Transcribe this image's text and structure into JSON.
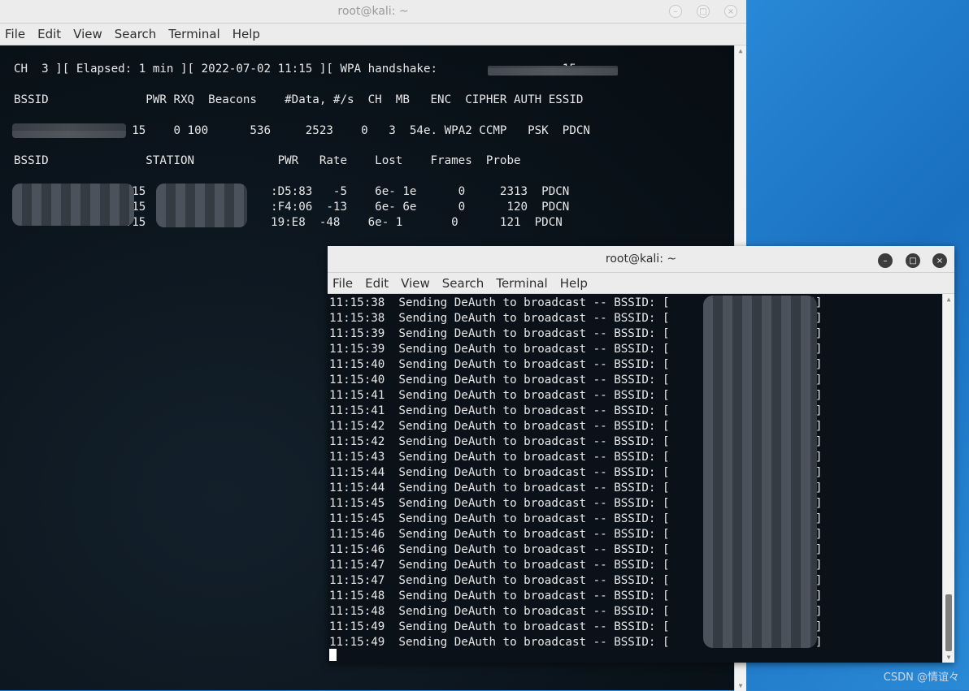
{
  "win_a": {
    "title": "root@kali: ~",
    "menu": [
      "File",
      "Edit",
      "View",
      "Search",
      "Terminal",
      "Help"
    ],
    "lines": [
      "CH  3 ][ Elapsed: 1 min ][ 2022-07-02 11:15 ][ WPA handshake:                  15",
      "BSSID              PWR RXQ  Beacons    #Data, #/s  CH  MB   ENC  CIPHER AUTH ESSID",
      "                 15    0 100      536     2523    0   3  54e. WPA2 CCMP   PSK  PDCN",
      "BSSID              STATION            PWR   Rate    Lost    Frames  Probe",
      "                :15                  :D5:83   -5    6e- 1e      0     2313  PDCN",
      "                 15                  :F4:06  -13    6e- 6e      0      120  PDCN",
      "                :15                  19:E8  -48    6e- 1       0      121  PDCN"
    ]
  },
  "win_b": {
    "title": "root@kali: ~",
    "menu": [
      "File",
      "Edit",
      "View",
      "Search",
      "Terminal",
      "Help"
    ],
    "lines": [
      "11:15:38  Sending DeAuth to broadcast -- BSSID: [                  :15]",
      "11:15:38  Sending DeAuth to broadcast -- BSSID: [                  :15]",
      "11:15:39  Sending DeAuth to broadcast -- BSSID: [                  :15]",
      "11:15:39  Sending DeAuth to broadcast -- BSSID: [                  :15]",
      "11:15:40  Sending DeAuth to broadcast -- BSSID: [                  :15]",
      "11:15:40  Sending DeAuth to broadcast -- BSSID: [                  :15]",
      "11:15:41  Sending DeAuth to broadcast -- BSSID: [                  :15]",
      "11:15:41  Sending DeAuth to broadcast -- BSSID: [                  :15]",
      "11:15:42  Sending DeAuth to broadcast -- BSSID: [                  :15]",
      "11:15:42  Sending DeAuth to broadcast -- BSSID: [                  :15]",
      "11:15:43  Sending DeAuth to broadcast -- BSSID: [                  :15]",
      "11:15:44  Sending DeAuth to broadcast -- BSSID: [                  :15]",
      "11:15:44  Sending DeAuth to broadcast -- BSSID: [                  :15]",
      "11:15:45  Sending DeAuth to broadcast -- BSSID: [                  :15]",
      "11:15:45  Sending DeAuth to broadcast -- BSSID: [                  :15]",
      "11:15:46  Sending DeAuth to broadcast -- BSSID: [                  :15]",
      "11:15:46  Sending DeAuth to broadcast -- BSSID: [                  :15]",
      "11:15:47  Sending DeAuth to broadcast -- BSSID: [                  :15]",
      "11:15:47  Sending DeAuth to broadcast -- BSSID: [                  :15]",
      "11:15:48  Sending DeAuth to broadcast -- BSSID: [                  :15]",
      "11:15:48  Sending DeAuth to broadcast -- BSSID: [                  :15]",
      "11:15:49  Sending DeAuth to broadcast -- BSSID: [                  :15]",
      "11:15:49  Sending DeAuth to broadcast -- BSSID: [                  :15]"
    ]
  },
  "watermark": "CSDN @情谊々",
  "colors": {
    "desktop": "#1d75c4",
    "terminal_bg": "#0b141c",
    "terminal_fg": "#e8e8e8"
  }
}
